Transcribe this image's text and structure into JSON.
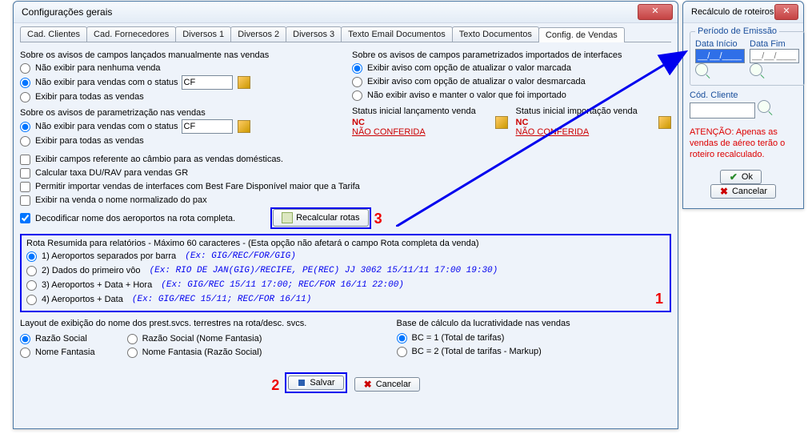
{
  "main": {
    "title": "Configurações gerais",
    "tabs": [
      "Cad. Clientes",
      "Cad. Fornecedores",
      "Diversos 1",
      "Diversos 2",
      "Diversos 3",
      "Texto Email Documentos",
      "Texto Documentos",
      "Config. de Vendas"
    ],
    "active_tab": 7,
    "left": {
      "avisos_manuais_title": "Sobre os avisos de campos lançados manualmente nas vendas",
      "r1": "Não exibir para nenhuma venda",
      "r2": "Não exibir para vendas com o status",
      "r2_value": "CF",
      "r3": "Exibir para todas as vendas",
      "avisos_param_title": "Sobre os avisos de parametrização nas vendas",
      "p1": "Não exibir para vendas com o status",
      "p1_value": "CF",
      "p2": "Exibir para todas as vendas",
      "chk1": "Exibir campos referente ao câmbio para as vendas domésticas.",
      "chk2": "Calcular taxa DU/RAV para vendas GR",
      "chk3": "Permitir importar vendas de interfaces com Best Fare Disponível maior que a Tarifa",
      "chk4": "Exibir na venda o nome normalizado do pax",
      "chk5": "Decodificar nome dos aeroportos na rota completa.",
      "recalc_btn": "Recalcular rotas"
    },
    "right": {
      "avisos_interface_title": "Sobre os avisos de campos parametrizados importados de interfaces",
      "r1": "Exibir aviso com opção de atualizar o valor marcada",
      "r2": "Exibir aviso com opção de atualizar o valor desmarcada",
      "r3": "Não exibir aviso e manter o valor que foi importado",
      "status1_title": "Status inicial lançamento venda",
      "status2_title": "Status inicial importação venda",
      "status_code": "NC",
      "status_desc": "NÃO CONFERIDA"
    },
    "rota": {
      "title": "Rota Resumida para relatórios - Máximo 60 caracteres - (Esta opção não afetará o campo Rota completa da venda)",
      "opt1": "1) Aeroportos separados por barra",
      "opt1_ex": "(Ex: GIG/REC/FOR/GIG)",
      "opt2": "2) Dados do primeiro vôo",
      "opt2_ex": "(Ex: RIO DE JAN(GIG)/RECIFE, PE(REC) JJ 3062 15/11/11 17:00 19:30)",
      "opt3": "3) Aeroportos + Data + Hora",
      "opt3_ex": "(Ex: GIG/REC 15/11 17:00; REC/FOR 16/11 22:00)",
      "opt4": "4) Aeroportos + Data",
      "opt4_ex": "(Ex: GIG/REC 15/11; REC/FOR 16/11)"
    },
    "layout": {
      "title": "Layout de exibição do nome dos prest.svcs. terrestres na rota/desc. svcs.",
      "o1": "Razão Social",
      "o2": "Nome Fantasia",
      "o3": "Razão Social (Nome Fantasia)",
      "o4": "Nome Fantasia (Razão Social)"
    },
    "base": {
      "title": "Base de cálculo da lucratividade nas vendas",
      "o1": "BC = 1 (Total de tarifas)",
      "o2": "BC = 2 (Total de tarifas - Markup)"
    },
    "footer": {
      "save": "Salvar",
      "cancel": "Cancelar"
    },
    "annot": {
      "n1": "1",
      "n2": "2",
      "n3": "3"
    }
  },
  "dialog": {
    "title": "Recálculo de roteiros",
    "legend": "Período de Emissão",
    "date_start_lbl": "Data Início",
    "date_end_lbl": "Data Fim",
    "date_val": "__/__/____",
    "client_lbl": "Cód. Cliente",
    "warn": "ATENÇÃO: Apenas as vendas de aéreo terão o roteiro recalculado.",
    "ok": "Ok",
    "cancel": "Cancelar"
  }
}
